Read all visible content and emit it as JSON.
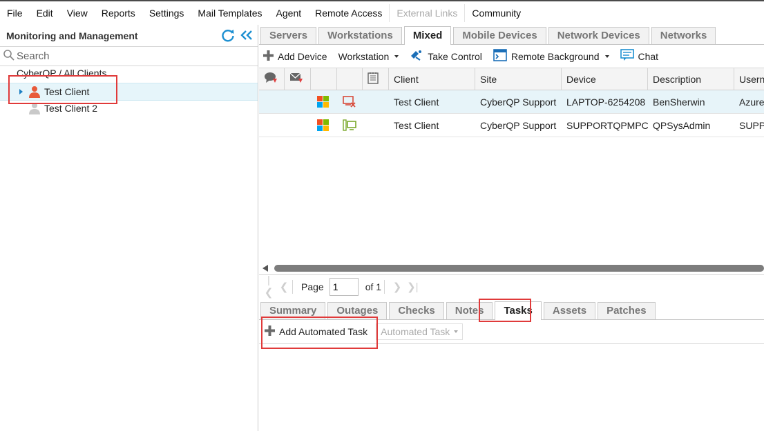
{
  "menu": [
    "File",
    "Edit",
    "View",
    "Reports",
    "Settings",
    "Mail Templates",
    "Agent",
    "Remote Access",
    "External Links",
    "Community"
  ],
  "left_panel": {
    "title": "Monitoring and Management",
    "search_placeholder": "Search",
    "tree_root": "CyberQP / All Clients",
    "clients": [
      "Test Client",
      "Test Client 2"
    ]
  },
  "device_tabs": [
    "Servers",
    "Workstations",
    "Mixed",
    "Mobile Devices",
    "Network Devices",
    "Networks"
  ],
  "device_toolbar": {
    "add_device": "Add Device",
    "workstation": "Workstation",
    "take_control": "Take Control",
    "remote_background": "Remote Background",
    "chat": "Chat"
  },
  "grid": {
    "columns": [
      "Client",
      "Site",
      "Device",
      "Description",
      "Userna"
    ],
    "rows": [
      {
        "client": "Test Client",
        "site": "CyberQP Support",
        "device": "LAPTOP-6254208",
        "description": "BenSherwin",
        "user": "AzureA"
      },
      {
        "client": "Test Client",
        "site": "CyberQP Support",
        "device": "SUPPORTQPMPC",
        "description": "QPSysAdmin",
        "user": "SUPPO"
      }
    ]
  },
  "pager": {
    "page_label": "Page",
    "page_value": "1",
    "of_label": "of 1"
  },
  "detail_tabs": [
    "Summary",
    "Outages",
    "Checks",
    "Notes",
    "Tasks",
    "Assets",
    "Patches"
  ],
  "detail_toolbar": {
    "add_task": "Add Automated Task",
    "automated_task": "Automated Task"
  },
  "colors": {
    "accent": "#1c7fc2",
    "highlight_box": "#e03a3a",
    "selected_row": "#e6f5fa"
  }
}
